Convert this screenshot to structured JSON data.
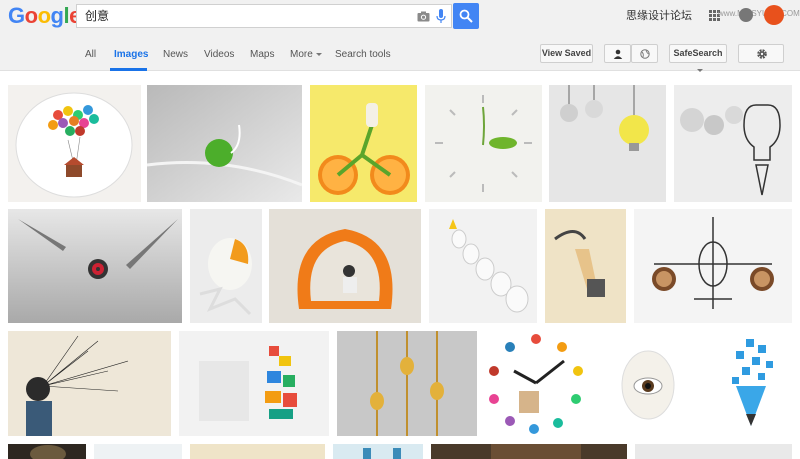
{
  "header": {
    "logo_letters": [
      "G",
      "o",
      "o",
      "g",
      "l",
      "e"
    ],
    "search_query": "创意",
    "user_name": "思缘设计论坛",
    "watermark": "www.MISSYUAN.COM"
  },
  "tabs": [
    {
      "label": "All"
    },
    {
      "label": "Images",
      "active": true
    },
    {
      "label": "News"
    },
    {
      "label": "Videos"
    },
    {
      "label": "Maps"
    },
    {
      "label": "More"
    },
    {
      "label": "Search tools"
    }
  ],
  "tools": {
    "view_saved_label": "View Saved",
    "safesearch_label": "SafeSearch"
  },
  "images": [
    {
      "desc": "balloon-house-plate"
    },
    {
      "desc": "green-apple-plug"
    },
    {
      "desc": "orange-bicycle"
    },
    {
      "desc": "seed-clock"
    },
    {
      "desc": "paper-lightbulbs"
    },
    {
      "desc": "lightbulb-drawing"
    },
    {
      "desc": "tweezers-dartboard"
    },
    {
      "desc": "cracked-egg-orange"
    },
    {
      "desc": "bookshelf-chair"
    },
    {
      "desc": "lightbulb-pencils"
    },
    {
      "desc": "paper-hand-cup"
    },
    {
      "desc": "coffee-airplane"
    },
    {
      "desc": "exploding-head"
    },
    {
      "desc": "lego-chair"
    },
    {
      "desc": "golden-spoons"
    },
    {
      "desc": "colorful-clock"
    },
    {
      "desc": "egg-eye"
    },
    {
      "desc": "pencil-icons"
    }
  ],
  "colors": {
    "accent": "#1a73e8",
    "search_button": "#4285f4",
    "avatar": "#e8511c"
  }
}
